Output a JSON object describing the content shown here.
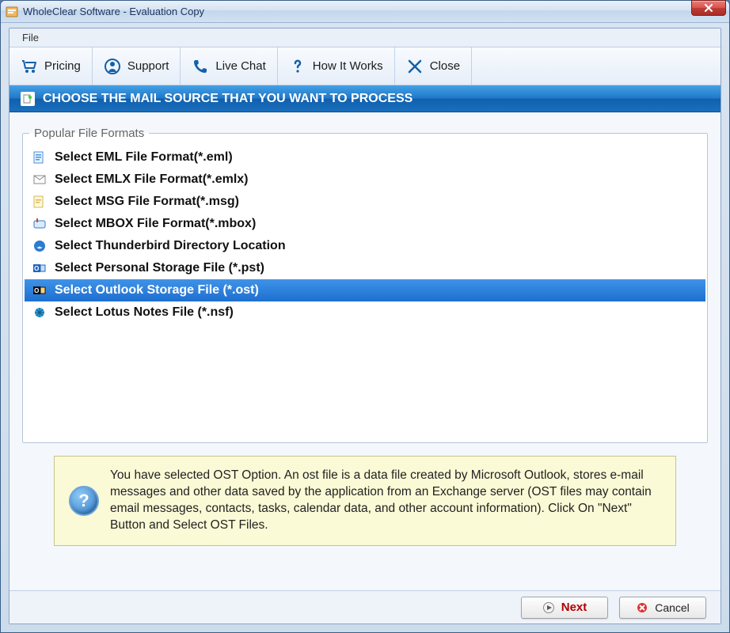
{
  "window": {
    "title": "WholeClear Software - Evaluation Copy"
  },
  "menubar": {
    "file": "File"
  },
  "toolbar": {
    "pricing": "Pricing",
    "support": "Support",
    "livechat": "Live Chat",
    "howitworks": "How It Works",
    "close": "Close"
  },
  "banner": {
    "text": "CHOOSE THE MAIL SOURCE THAT YOU WANT TO PROCESS"
  },
  "formats": {
    "legend": "Popular File Formats",
    "items": [
      {
        "label": "Select EML File Format(*.eml)"
      },
      {
        "label": "Select EMLX File Format(*.emlx)"
      },
      {
        "label": "Select MSG File Format(*.msg)"
      },
      {
        "label": "Select MBOX File Format(*.mbox)"
      },
      {
        "label": "Select Thunderbird Directory Location"
      },
      {
        "label": "Select Personal Storage File (*.pst)"
      },
      {
        "label": "Select Outlook Storage File (*.ost)"
      },
      {
        "label": "Select Lotus Notes File (*.nsf)"
      }
    ],
    "selected_index": 6
  },
  "info": {
    "text": "You have selected OST Option. An ost file is a data file created by Microsoft Outlook, stores e-mail messages and other data saved by the application from an Exchange server (OST files may contain email messages, contacts, tasks, calendar data, and other account information). Click On \"Next\" Button and Select OST Files."
  },
  "buttons": {
    "next": "Next",
    "cancel": "Cancel"
  }
}
